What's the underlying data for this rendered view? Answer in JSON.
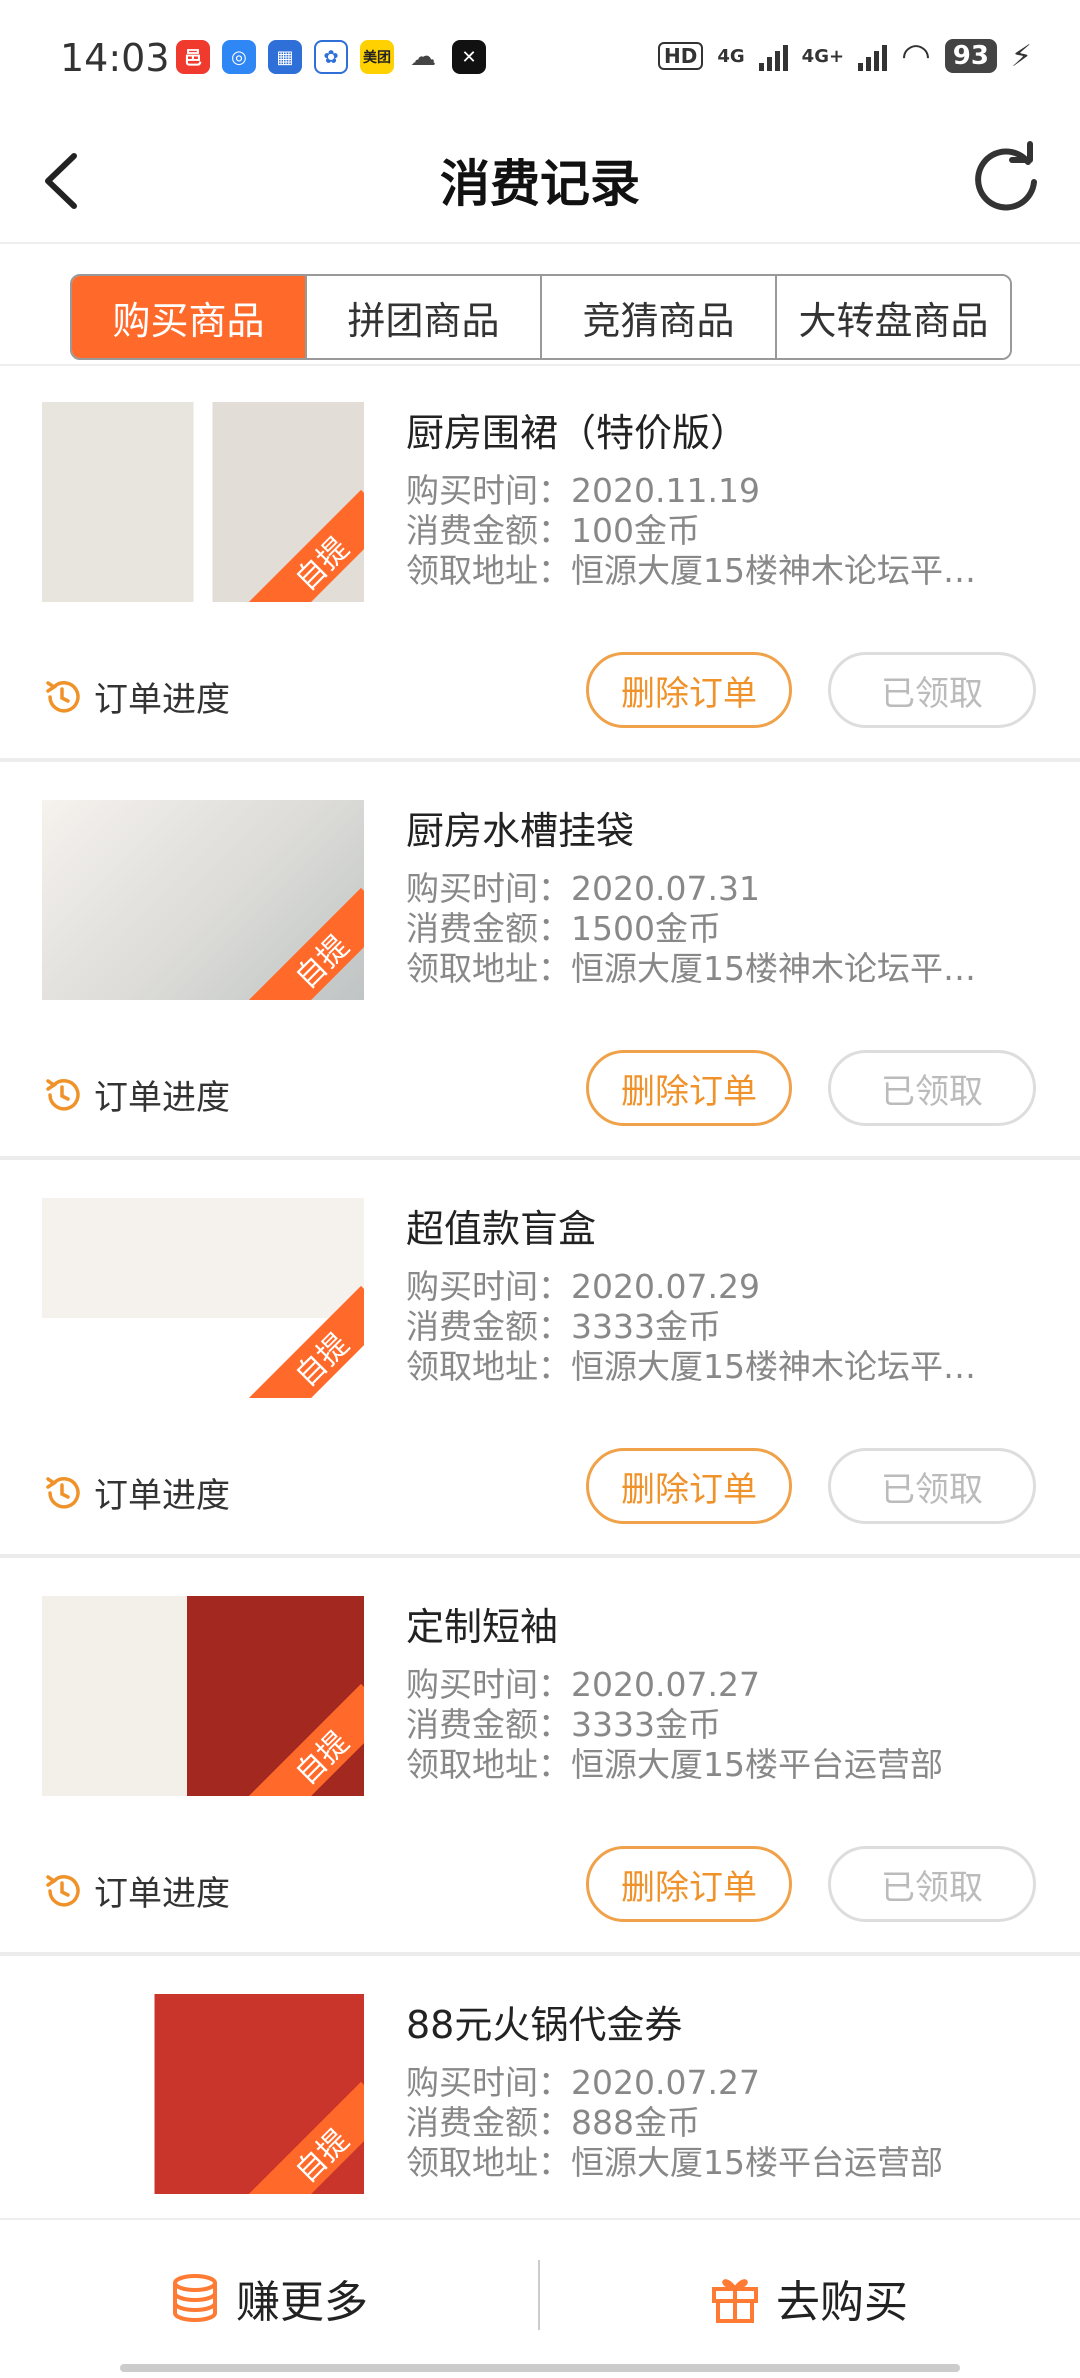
{
  "status_bar": {
    "time": "14:03",
    "battery": "93",
    "network1": "4G",
    "network2": "4G+",
    "hd": "HD"
  },
  "header": {
    "title": "消费记录",
    "back_icon": "chevron-left-icon",
    "refresh_icon": "refresh-icon"
  },
  "tabs": [
    {
      "label": "购买商品",
      "active": true
    },
    {
      "label": "拼团商品",
      "active": false
    },
    {
      "label": "竞猜商品",
      "active": false
    },
    {
      "label": "大转盘商品",
      "active": false
    }
  ],
  "labels": {
    "time_label": "购买时间：",
    "amount_label": "消费金额：",
    "address_label": "领取地址：",
    "progress_label": "订单进度",
    "delete_label": "删除订单",
    "received_label": "已领取",
    "badge": "自提"
  },
  "orders": [
    {
      "name": "厨房围裙（特价版）",
      "time": "2020.11.19",
      "amount": "100金币",
      "address": "恒源大厦15楼神木论坛平…"
    },
    {
      "name": "厨房水槽挂袋",
      "time": "2020.07.31",
      "amount": "1500金币",
      "address": "恒源大厦15楼神木论坛平…"
    },
    {
      "name": "超值款盲盒",
      "time": "2020.07.29",
      "amount": "3333金币",
      "address": "恒源大厦15楼神木论坛平…"
    },
    {
      "name": "定制短袖",
      "time": "2020.07.27",
      "amount": "3333金币",
      "address": "恒源大厦15楼平台运营部"
    },
    {
      "name": "88元火锅代金券",
      "time": "2020.07.27",
      "amount": "888金币",
      "address": "恒源大厦15楼平台运营部"
    }
  ],
  "bottom_bar": {
    "earn_label": "赚更多",
    "buy_label": "去购买"
  },
  "colors": {
    "accent": "#ff6a2b",
    "delete_border": "#f0a24a"
  }
}
